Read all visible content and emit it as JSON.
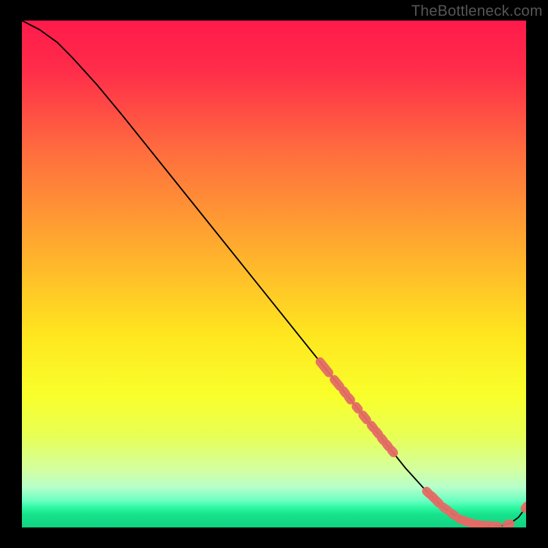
{
  "watermark": "TheBottleneck.com",
  "chart_data": {
    "type": "line",
    "title": "",
    "xlabel": "",
    "ylabel": "",
    "xlim": [
      0,
      100
    ],
    "ylim": [
      0,
      100
    ],
    "background": {
      "type": "vertical-gradient",
      "stops": [
        {
          "offset": 0.0,
          "color": "#ff1a4b"
        },
        {
          "offset": 0.1,
          "color": "#ff2d4a"
        },
        {
          "offset": 0.25,
          "color": "#ff6a3f"
        },
        {
          "offset": 0.45,
          "color": "#ffad2e"
        },
        {
          "offset": 0.62,
          "color": "#ffe61f"
        },
        {
          "offset": 0.74,
          "color": "#f9ff2b"
        },
        {
          "offset": 0.82,
          "color": "#e7ff55"
        },
        {
          "offset": 0.885,
          "color": "#d4ffa0"
        },
        {
          "offset": 0.92,
          "color": "#b7ffca"
        },
        {
          "offset": 0.947,
          "color": "#6cffc2"
        },
        {
          "offset": 0.962,
          "color": "#29f7a0"
        },
        {
          "offset": 0.975,
          "color": "#17e18b"
        },
        {
          "offset": 1.0,
          "color": "#11d381"
        }
      ]
    },
    "series": [
      {
        "name": "bottleneck-curve",
        "color": "#000000",
        "x": [
          0,
          3.5,
          7,
          10,
          15,
          20,
          30,
          40,
          50,
          60,
          66,
          72,
          76,
          80,
          83,
          86,
          89,
          92,
          95,
          97,
          98.5,
          100
        ],
        "y": [
          100,
          98.2,
          95.7,
          92.7,
          87.2,
          81.2,
          68.8,
          56.4,
          44.0,
          31.6,
          24.2,
          16.8,
          11.8,
          7.4,
          4.4,
          2.3,
          1.0,
          0.4,
          0.3,
          0.9,
          2.0,
          4.0
        ]
      }
    ],
    "markers": {
      "name": "highlighted-points",
      "shape": "rounded-rect",
      "color": "#e46b65",
      "points": [
        {
          "x": 60.0,
          "y": 31.6,
          "len": 3.2
        },
        {
          "x": 62.5,
          "y": 28.5,
          "len": 2.2
        },
        {
          "x": 64.0,
          "y": 26.7,
          "len": 1.0
        },
        {
          "x": 65.0,
          "y": 25.4,
          "len": 0.9
        },
        {
          "x": 66.5,
          "y": 23.6,
          "len": 1.0
        },
        {
          "x": 68.0,
          "y": 21.7,
          "len": 1.6
        },
        {
          "x": 69.5,
          "y": 19.9,
          "len": 0.9
        },
        {
          "x": 70.5,
          "y": 18.7,
          "len": 0.9
        },
        {
          "x": 71.5,
          "y": 17.4,
          "len": 0.9
        },
        {
          "x": 72.5,
          "y": 16.2,
          "len": 0.9
        },
        {
          "x": 73.5,
          "y": 15.0,
          "len": 0.9
        },
        {
          "x": 80.5,
          "y": 6.9,
          "len": 0.8
        },
        {
          "x": 81.5,
          "y": 6.0,
          "len": 0.8
        },
        {
          "x": 82.5,
          "y": 5.0,
          "len": 1.2
        },
        {
          "x": 84.0,
          "y": 3.7,
          "len": 1.5
        },
        {
          "x": 85.5,
          "y": 2.6,
          "len": 1.2
        },
        {
          "x": 87.0,
          "y": 1.6,
          "len": 0.8
        },
        {
          "x": 88.0,
          "y": 1.2,
          "len": 0.8
        },
        {
          "x": 89.0,
          "y": 0.9,
          "len": 0.9
        },
        {
          "x": 90.2,
          "y": 0.6,
          "len": 0.8
        },
        {
          "x": 91.2,
          "y": 0.45,
          "len": 0.8
        },
        {
          "x": 92.5,
          "y": 0.4,
          "len": 0.8
        },
        {
          "x": 94.0,
          "y": 0.3,
          "len": 0.8
        },
        {
          "x": 96.5,
          "y": 0.6,
          "len": 0.8
        },
        {
          "x": 100.0,
          "y": 4.0,
          "len": 0.8
        }
      ]
    }
  }
}
